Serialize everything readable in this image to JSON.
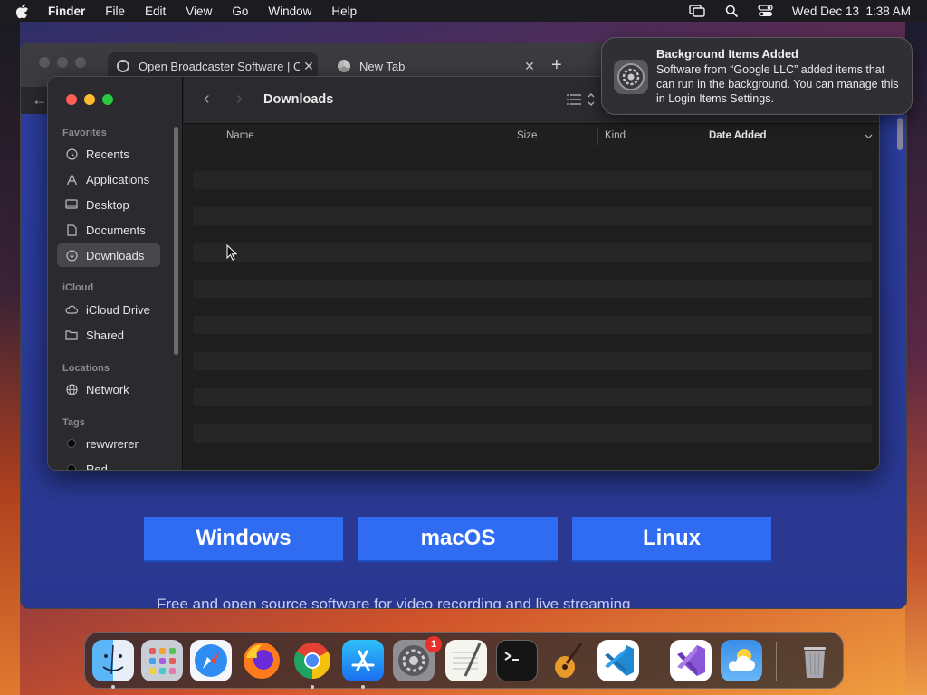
{
  "menubar": {
    "app_name": "Finder",
    "items": [
      "File",
      "Edit",
      "View",
      "Go",
      "Window",
      "Help"
    ],
    "datetime": "Wed Dec 13  1:38 AM",
    "icons": [
      "screen-mirroring-icon",
      "spotlight-search-icon",
      "control-center-icon"
    ]
  },
  "browser": {
    "tabs": [
      {
        "label": "Open Broadcaster Software | O",
        "icon": "obs-icon"
      },
      {
        "label": "New Tab",
        "icon": "chrome-icon"
      }
    ],
    "new_tab_label": "+",
    "downloads": [
      "Windows",
      "macOS",
      "Linux"
    ],
    "partial_text": "Free and open source software for video recording and live streaming"
  },
  "finder": {
    "title": "Downloads",
    "sidebar": {
      "favorites_label": "Favorites",
      "favorites": [
        "Recents",
        "Applications",
        "Desktop",
        "Documents",
        "Downloads"
      ],
      "icloud_label": "iCloud",
      "icloud": [
        "iCloud Drive",
        "Shared"
      ],
      "locations_label": "Locations",
      "locations": [
        "Network"
      ],
      "tags_label": "Tags",
      "tags": [
        "rewwrerer",
        "Red"
      ]
    },
    "columns": [
      "Name",
      "Size",
      "Kind",
      "Date Added"
    ],
    "active_sort_column": "Date Added"
  },
  "notification": {
    "title": "Background Items Added",
    "body": "Software from “Google LLC” added items that can run in the background. You can manage this in Login Items Settings."
  },
  "dock": {
    "apps": [
      "Finder",
      "Launchpad",
      "Safari",
      "Firefox",
      "Google Chrome",
      "App Store",
      "System Settings",
      "TextEdit",
      "Terminal",
      "GarageBand",
      "Visual Studio Code",
      "Visual Studio",
      "Weather",
      "Trash"
    ],
    "system_settings_badge": "1"
  },
  "colors": {
    "accent_blue": "#2f6cf2",
    "close_red": "#ff5f57",
    "minimize_yellow": "#febc2e",
    "zoom_green": "#28c840"
  }
}
